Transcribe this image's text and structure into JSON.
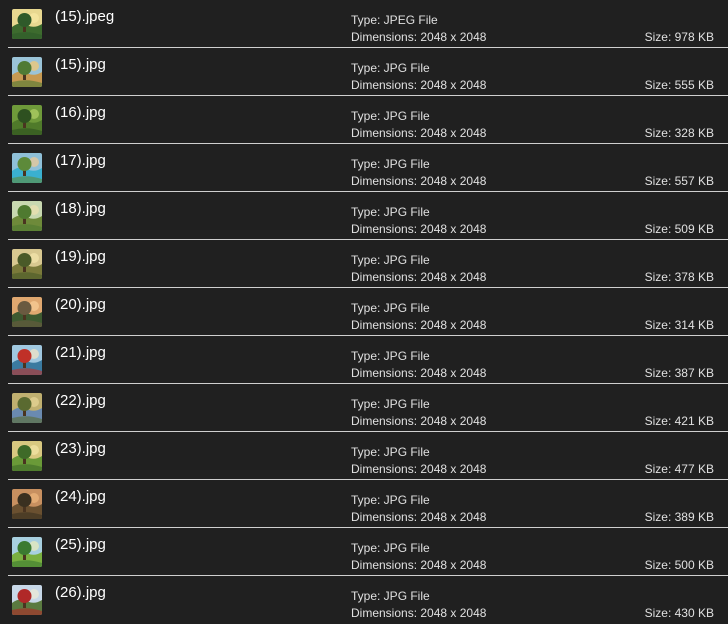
{
  "files": [
    {
      "name": "(15).jpeg",
      "type": "Type: JPEG File",
      "dimensions": "Dimensions: 2048 x 2048",
      "size": "Size: 978 KB",
      "thumb_icon": "sunlit-forest-path-thumbnail",
      "colors": {
        "sky": "#e8d890",
        "top": "#2f5a2a",
        "ground": "#3d6b2e",
        "accent": "#f4e6a0"
      }
    },
    {
      "name": "(15).jpg",
      "type": "Type: JPG File",
      "dimensions": "Dimensions: 2048 x 2048",
      "size": "Size: 555 KB",
      "thumb_icon": "cottage-landscape-thumbnail",
      "colors": {
        "sky": "#9bc4d8",
        "top": "#4f7a34",
        "ground": "#c79a52",
        "accent": "#e8c880"
      }
    },
    {
      "name": "(16).jpg",
      "type": "Type: JPG File",
      "dimensions": "Dimensions: 2048 x 2048",
      "size": "Size: 328 KB",
      "thumb_icon": "forest-trees-thumbnail",
      "colors": {
        "sky": "#6f9a3a",
        "top": "#2e5020",
        "ground": "#4f7a2a",
        "accent": "#a8c860"
      }
    },
    {
      "name": "(17).jpg",
      "type": "Type: JPG File",
      "dimensions": "Dimensions: 2048 x 2048",
      "size": "Size: 557 KB",
      "thumb_icon": "house-pool-thumbnail",
      "colors": {
        "sky": "#8fc0d8",
        "top": "#5d8a3a",
        "ground": "#3ab0d0",
        "accent": "#e0c8a0"
      }
    },
    {
      "name": "(18).jpg",
      "type": "Type: JPG File",
      "dimensions": "Dimensions: 2048 x 2048",
      "size": "Size: 509 KB",
      "thumb_icon": "lone-tree-thumbnail",
      "colors": {
        "sky": "#c8d8b0",
        "top": "#4f7a30",
        "ground": "#6e8a3a",
        "accent": "#e8e0b0"
      }
    },
    {
      "name": "(19).jpg",
      "type": "Type: JPG File",
      "dimensions": "Dimensions: 2048 x 2048",
      "size": "Size: 378 KB",
      "thumb_icon": "misty-forest-thumbnail",
      "colors": {
        "sky": "#d8c890",
        "top": "#4a5a28",
        "ground": "#7a7a3a",
        "accent": "#f0e0a8"
      }
    },
    {
      "name": "(20).jpg",
      "type": "Type: JPG File",
      "dimensions": "Dimensions: 2048 x 2048",
      "size": "Size: 314 KB",
      "thumb_icon": "sunset-valley-thumbnail",
      "colors": {
        "sky": "#e0a870",
        "top": "#6a5a40",
        "ground": "#3e5a30",
        "accent": "#f4c890"
      }
    },
    {
      "name": "(21).jpg",
      "type": "Type: JPG File",
      "dimensions": "Dimensions: 2048 x 2048",
      "size": "Size: 387 KB",
      "thumb_icon": "red-bridge-thumbnail",
      "colors": {
        "sky": "#a0c8e0",
        "top": "#c03028",
        "ground": "#3a7aa0",
        "accent": "#e8e0c8"
      }
    },
    {
      "name": "(22).jpg",
      "type": "Type: JPG File",
      "dimensions": "Dimensions: 2048 x 2048",
      "size": "Size: 421 KB",
      "thumb_icon": "stream-forest-thumbnail",
      "colors": {
        "sky": "#c0b070",
        "top": "#5a6a30",
        "ground": "#6a8ab0",
        "accent": "#e0d090"
      }
    },
    {
      "name": "(23).jpg",
      "type": "Type: JPG File",
      "dimensions": "Dimensions: 2048 x 2048",
      "size": "Size: 477 KB",
      "thumb_icon": "meadow-tree-thumbnail",
      "colors": {
        "sky": "#d8c880",
        "top": "#3e6a28",
        "ground": "#6a9a38",
        "accent": "#f0e0a0"
      }
    },
    {
      "name": "(24).jpg",
      "type": "Type: JPG File",
      "dimensions": "Dimensions: 2048 x 2048",
      "size": "Size: 389 KB",
      "thumb_icon": "dusk-tree-thumbnail",
      "colors": {
        "sky": "#c89060",
        "top": "#3a3020",
        "ground": "#6a5030",
        "accent": "#e8b078"
      }
    },
    {
      "name": "(25).jpg",
      "type": "Type: JPG File",
      "dimensions": "Dimensions: 2048 x 2048",
      "size": "Size: 500 KB",
      "thumb_icon": "green-hills-thumbnail",
      "colors": {
        "sky": "#a8d0e0",
        "top": "#3a7a30",
        "ground": "#7ab040",
        "accent": "#e0e8c0"
      }
    },
    {
      "name": "(26).jpg",
      "type": "Type: JPG File",
      "dimensions": "Dimensions: 2048 x 2048",
      "size": "Size: 430 KB",
      "thumb_icon": "red-tree-thumbnail",
      "colors": {
        "sky": "#c8d8e8",
        "top": "#b02828",
        "ground": "#5a7a40",
        "accent": "#e8e8d8"
      }
    }
  ]
}
